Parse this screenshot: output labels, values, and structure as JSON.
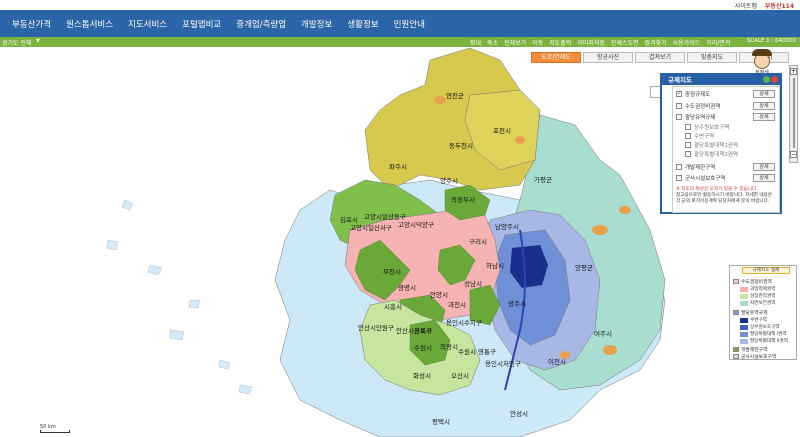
{
  "header": {
    "links": [
      "사이트맵"
    ],
    "brand": "부동산114"
  },
  "nav": {
    "items": [
      "부동산가격",
      "원스톱서비스",
      "지도서비스",
      "포털맵비교",
      "중개업/측량업",
      "개발정보",
      "생활정보",
      "민원안내"
    ]
  },
  "toolbar": {
    "region": "경기도 전체",
    "tools": [
      "확대",
      "축소",
      "전체보기",
      "이동",
      "지도출력",
      "이미지저장",
      "인쇄스도면",
      "즐겨찾기",
      "사용가이드",
      "거리/면적"
    ],
    "scale": "SCALE 1 : 640000"
  },
  "map": {
    "tabs": [
      {
        "label": "도로/연제도",
        "active": true
      },
      {
        "label": "항공사진",
        "active": false
      },
      {
        "label": "겹쳐보기",
        "active": false
      },
      {
        "label": "맞춤지도",
        "active": false
      },
      {
        "label": "네이버",
        "active": false
      }
    ],
    "helper_label": "정정센",
    "scale_text": "50 km",
    "places": [
      {
        "name": "연천군"
      },
      {
        "name": "포천시"
      },
      {
        "name": "동두천시"
      },
      {
        "name": "파주시"
      },
      {
        "name": "양주시"
      },
      {
        "name": "가평군"
      },
      {
        "name": "의정부시"
      },
      {
        "name": "고양시일산동구"
      },
      {
        "name": "김포시"
      },
      {
        "name": "고양시일산서구"
      },
      {
        "name": "고양시덕양구"
      },
      {
        "name": "구리시"
      },
      {
        "name": "남양주시"
      },
      {
        "name": "하남시"
      },
      {
        "name": "양평군"
      },
      {
        "name": "부천시"
      },
      {
        "name": "광명시"
      },
      {
        "name": "성남시"
      },
      {
        "name": "안양시"
      },
      {
        "name": "광주시"
      },
      {
        "name": "시흥시"
      },
      {
        "name": "과천시"
      },
      {
        "name": "안산시단원구"
      },
      {
        "name": "안산시상록구"
      },
      {
        "name": "수원시"
      },
      {
        "name": "용인시수지구"
      },
      {
        "name": "군포시"
      },
      {
        "name": "의왕시"
      },
      {
        "name": "수원시 영통구"
      },
      {
        "name": "여주시"
      },
      {
        "name": "용인시처인구"
      },
      {
        "name": "이천시"
      },
      {
        "name": "화성시"
      },
      {
        "name": "오산시"
      },
      {
        "name": "안성시"
      },
      {
        "name": "평택시"
      }
    ]
  },
  "panel": {
    "title": "규제지도",
    "rows": [
      {
        "label": "중점규제도",
        "checked": true,
        "detail": "상세"
      },
      {
        "label": "수도권정비권역",
        "checked": false,
        "detail": "상세"
      },
      {
        "label": "팔당유역규제",
        "checked": false,
        "detail": "상세"
      },
      {
        "label": "상수원보호구역",
        "sub": true
      },
      {
        "label": "수변구역",
        "sub": true
      },
      {
        "label": "팔당특별대책1권역",
        "sub": true
      },
      {
        "label": "팔당특별대책2권역",
        "sub": true
      },
      {
        "label": "개발제한구역",
        "checked": false,
        "detail": "상세"
      },
      {
        "label": "군사시설보호구역",
        "checked": false,
        "detail": "상세"
      }
    ],
    "note_red": "※ 지도의 특성상 오차가 있을 수 있습니다.",
    "note_lines": [
      "참고용으로만 활용하시기 바랍니다. 자세한 내용은",
      "각 군의 토지이용계획 담당자에게 문의 바랍니다."
    ]
  },
  "legend": {
    "title": "규제지도 범례",
    "groups": [
      {
        "name": "수도권정비권역",
        "color": "#f8c8c8",
        "items": [
          {
            "label": "과밀억제권역",
            "color": "#f5b3b3"
          },
          {
            "label": "성장관리권역",
            "color": "#c7e59e"
          },
          {
            "label": "자연보전권역",
            "color": "#a8ddd0"
          }
        ]
      },
      {
        "name": "팔당유역규제",
        "color": "#7a9edc",
        "items": [
          {
            "label": "수변구역",
            "color": "#1a2f8c"
          },
          {
            "label": "상수원보호구역",
            "color": "#3d5fc4"
          },
          {
            "label": "팔당특별대책 I권역",
            "color": "#6f8fd6"
          },
          {
            "label": "팔당특별대책 II권역",
            "color": "#a8b8e6"
          }
        ]
      },
      {
        "name": "개발제한구역",
        "color": "#6aa83a",
        "items": []
      },
      {
        "name": "군사시설보호구역",
        "color": "#dcdcdc",
        "items": []
      }
    ]
  }
}
